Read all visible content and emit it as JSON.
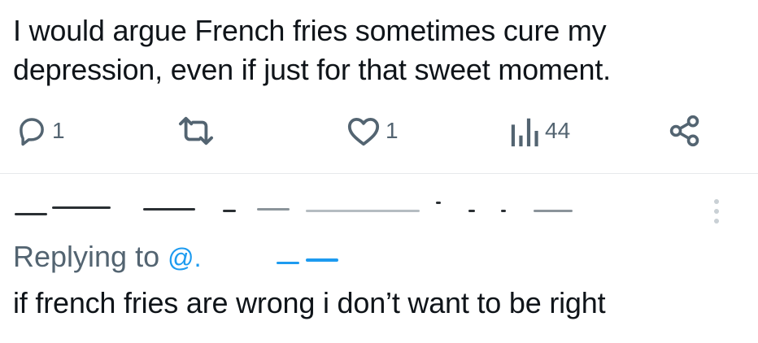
{
  "post": {
    "text_line1": "I would argue French fries sometimes cure my",
    "text_line2": "depression, even if just for that sweet moment."
  },
  "actions": {
    "reply_count": "1",
    "retweet_count": "",
    "like_count": "1",
    "views_count": "44",
    "icons": {
      "reply": "reply-bubble-icon",
      "retweet": "retweet-icon",
      "like": "heart-icon",
      "views": "views-bar-chart-icon",
      "share": "share-icon"
    }
  },
  "reply": {
    "replying_to_label": "Replying to",
    "mention_prefix": "@.",
    "text": "if french fries are wrong i don’t want to be right"
  },
  "colors": {
    "text_primary": "#0f1419",
    "text_secondary": "#536471",
    "accent": "#1d9bf0",
    "divider": "#e6e9ec"
  }
}
